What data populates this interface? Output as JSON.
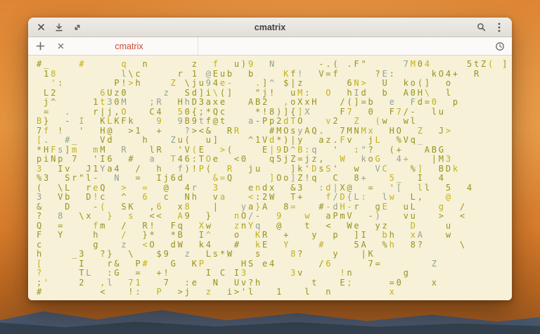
{
  "window": {
    "title": "cmatrix"
  },
  "headerbar": {
    "icons": [
      "close-icon",
      "download-icon",
      "fullscreen-icon",
      "search-icon",
      "menu-dots-icon"
    ]
  },
  "tabbar": {
    "new_tab_icon": "plus-icon",
    "active_tab_label": "cmatrix",
    "tab_close_icon": "close-icon",
    "right_icon": "clock-icon"
  },
  "colors": {
    "tab_label_accent": "#cf4a2e",
    "terminal_background": "#f7f1d8",
    "headerbar_background": "#e9e5e1",
    "wallpaper_orange": "#e6953f",
    "mountain_dark": "#33414f"
  },
  "terminal": {
    "program": "cmatrix",
    "palette": [
      "#97931d",
      "#c2b117",
      "#8fa391"
    ],
    "lines": [
      "#_    #     q  n      z  f  u)9  N      -.( .F\"     7M04     5tZ( ]",
      " 18         l\\c     r 1 @Eub  b    Kf!  V=f     ?E:     kO4+  R",
      "  ':       P!>h    Z \\ju94e-   .]^ $|z      6N>  U  ko(]  o",
      " L2      6Uz0     z  Sd]i\\(]   \"j!  uM:  O  hId  b  A0H\\  l",
      " j^     1t30M   ;R  HhD3axe   AB2  ,oXxH   /(]=b  e  Fd=0  p",
      " =  .   r|j,O   C4  50{;*Qc    *!8)]{]X    F7  0  F7/-  lu",
      "B}  - I  KLKFk   9  9B9tf@t   a-Pp2dTO   v2  Z  (w  wl",
      "7f !  '  H@  >1  +   ?><&  RR    #MOsyAQ.  7MNMx  HO  Z  J>",
      "[.  #_   Vd    h   Zu(  u]    ^1Vd*)|y  az.Fv  jL  %Vq_",
      "*HFs]m  mM  R   lR  'V(E  >(    E|9D^B:q  '  :\"?  (+   ABG",
      "piNp 7  'I6  #  a  T46:TOe  <0   q5jZ=jz,  W  koG  4+   |M3",
      "3  Iv  J1Ya4  /  h  f)!P(  R  ju    ]k'DsS'  w  VC   %]  BDk",
      "%3  Sr\"l-  N  =  Ij6d    &=Q     ]Oo]Z!q  C  8+   5_  I  4",
      "(  \\L  reQ  >  =  @  4r  3    endx  &3  :d|X@  =  '[  ll  5  4",
      "3  Vb  D!c  ^  6  c  Nh  va   <:2W  T+   f/D{L:  lw  L,   @",
      "&   D   -(  SK  ,6  x8   |   ya}A  8=   #-dH-r  gE  uL   g  /",
      "?  8  \\x  }  s  <<  A9  }   nO/-  9   w  aPmV  -)   vu   >  <",
      "Q  =    fm  /  R!  Fq  Xw   znYq  @   t  <  We  yz   D    u",
      "F  Y    h   /  }*  *B  I^   o  KR  +   y  p  ]I  bh  xA   w",
      "c       g   z  <O  dW  k4   #  kE  Y    #    5A  %h  8?     \\",
      "h    _3  ?}  \\   $9  z  Ls*W   s    8?    y   |K",
      "[     I   r&  P#   G  KP     HS e4      /6     7=       Z",
      "?     TL  :G  =  +!     I C I3      3v     !n       g",
      ";'    2  ,l  71   7  :e  N  Uv?h       t   E;     =0    x",
      "#        <   !:  P  >j  z  i>'l   1   l  n        x"
    ]
  }
}
